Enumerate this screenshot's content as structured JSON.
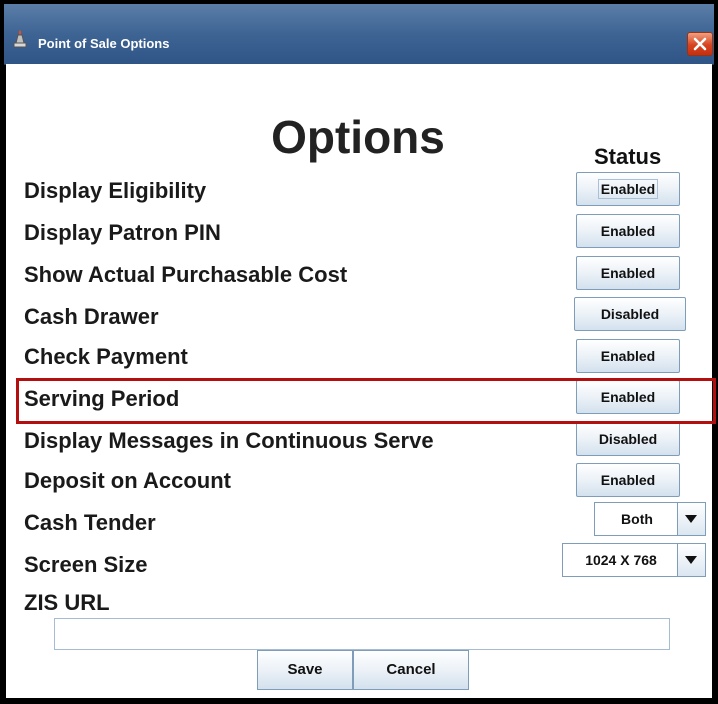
{
  "window": {
    "title": "Point of Sale Options",
    "app_icon": "pos-app-icon",
    "close_icon": "close-icon"
  },
  "main": {
    "heading": "Options",
    "status_header": "Status"
  },
  "options": [
    {
      "label": "Display Eligibility",
      "status": "Enabled"
    },
    {
      "label": "Display Patron PIN",
      "status": "Enabled"
    },
    {
      "label": "Show Actual Purchasable Cost",
      "status": "Enabled"
    },
    {
      "label": "Cash Drawer",
      "status": "Disabled"
    },
    {
      "label": "Check Payment",
      "status": "Enabled"
    },
    {
      "label": "Serving Period",
      "status": "Enabled"
    },
    {
      "label": "Display Messages in Continuous Serve",
      "status": "Disabled"
    },
    {
      "label": "Deposit on Account",
      "status": "Enabled"
    }
  ],
  "cash_tender": {
    "label": "Cash Tender",
    "value": "Both"
  },
  "screen_size": {
    "label": "Screen Size",
    "value": "1024 X 768"
  },
  "zis_url": {
    "label": "ZIS URL",
    "value": "",
    "placeholder": ""
  },
  "actions": {
    "save": "Save",
    "cancel": "Cancel"
  },
  "colors": {
    "highlight": "#b40f0f",
    "titlebar": "#3e6494"
  }
}
